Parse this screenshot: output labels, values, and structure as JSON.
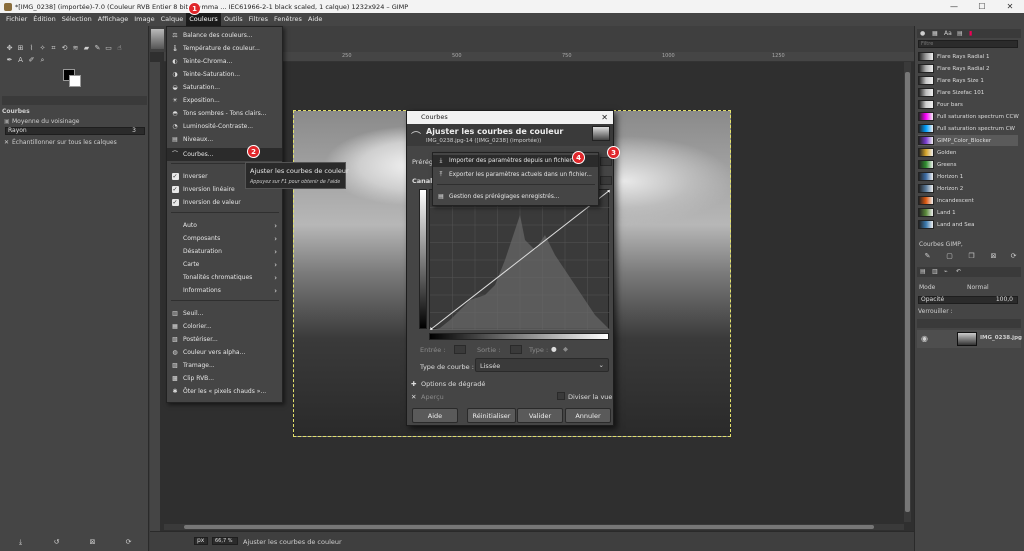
{
  "window": {
    "title": "*[IMG_0238] (importée)-7.0 (Couleur RVB Entier 8 bits gamma ... IEC61966-2-1 black scaled, 1 calque) 1232x924 – GIMP",
    "min": "—",
    "max": "☐",
    "close": "✕"
  },
  "menubar": [
    "Fichier",
    "Édition",
    "Sélection",
    "Affichage",
    "Image",
    "Calque",
    "Couleurs",
    "Outils",
    "Filtres",
    "Fenêtres",
    "Aide"
  ],
  "toolbox": {
    "panel_title": "Courbes",
    "average_label": "Moyenne du voisinage",
    "radius_label": "Rayon",
    "radius_value": "3",
    "sample_merged": "Échantillonner sur tous les calques"
  },
  "colors_menu": {
    "items": [
      {
        "label": "Balance des couleurs...",
        "icon": "⚖"
      },
      {
        "label": "Température de couleur...",
        "icon": "🌡"
      },
      {
        "label": "Teinte-Chroma...",
        "icon": "◐"
      },
      {
        "label": "Teinte-Saturation...",
        "icon": "◑"
      },
      {
        "label": "Saturation...",
        "icon": "◒"
      },
      {
        "label": "Exposition...",
        "icon": "☀"
      },
      {
        "label": "Tons sombres - Tons clairs...",
        "icon": "◓"
      },
      {
        "label": "Luminosité-Contraste...",
        "icon": "◔"
      },
      {
        "label": "Niveaux...",
        "icon": "▤"
      },
      {
        "label": "Courbes...",
        "icon": "⌒"
      },
      {
        "label": "Inverser",
        "icon": "✓"
      },
      {
        "label": "Inversion linéaire",
        "icon": "✓"
      },
      {
        "label": "Inversion de valeur",
        "icon": "✓"
      },
      {
        "label": "Auto"
      },
      {
        "label": "Composants"
      },
      {
        "label": "Désaturation"
      },
      {
        "label": "Carte"
      },
      {
        "label": "Tonalités chromatiques"
      },
      {
        "label": "Informations"
      },
      {
        "label": "Seuil...",
        "icon": "▥"
      },
      {
        "label": "Colorier...",
        "icon": "▦"
      },
      {
        "label": "Postériser...",
        "icon": "▧"
      },
      {
        "label": "Couleur vers alpha...",
        "icon": "◍"
      },
      {
        "label": "Tramage...",
        "icon": "▨"
      },
      {
        "label": "Clip RVB...",
        "icon": "▩"
      },
      {
        "label": "Ôter les « pixels chauds »...",
        "icon": "✱"
      }
    ]
  },
  "tooltip": {
    "title": "Ajuster les courbes de couleur",
    "help": "Appuyez sur F1 pour obtenir de l'aide"
  },
  "dialog": {
    "window_title": "Courbes",
    "heading": "Ajuster les courbes de couleur",
    "subheading": "IMG_0238.jpg-14 ([IMG_0238] (importée))",
    "presets_label": "Prérégl",
    "channel_label": "Canal",
    "entry_label": "Entrée :",
    "output_label": "Sortie :",
    "type_label": "Type :",
    "curve_type_label": "Type de courbe :",
    "curve_type_value": "Lissée",
    "gradient_options": "Options de dégradé",
    "preview": "Aperçu",
    "split_view": "Diviser la vue",
    "buttons": [
      "Aide",
      "Réinitialiser",
      "Valider",
      "Annuler"
    ],
    "presets_menu": [
      "Importer des paramètres depuis un fichier...",
      "Exporter les paramètres actuels dans un fichier...",
      "Gestion des préréglages enregistrés..."
    ]
  },
  "dock": {
    "filter_placeholder": "Filtre",
    "gradients": [
      {
        "name": "Flare Rays Radial 1",
        "color": "#9a9a9a"
      },
      {
        "name": "Flare Rays Radial 2",
        "color": "#b0b0b0"
      },
      {
        "name": "Flare Rays Size 1",
        "color": "#c8c8c8"
      },
      {
        "name": "Flare Sizefac 101",
        "color": "#bcbcbc"
      },
      {
        "name": "Four bars",
        "color": "#d0d0d0"
      },
      {
        "name": "Full saturation spectrum CCW",
        "color": "#ff00ff"
      },
      {
        "name": "Full saturation spectrum CW",
        "color": "#00a0ff"
      },
      {
        "name": "GIMP_Color_Blocker",
        "color": "#7a3bd0"
      },
      {
        "name": "Golden",
        "color": "#d8a62a"
      },
      {
        "name": "Greens",
        "color": "#2f8f2f"
      },
      {
        "name": "Horizon 1",
        "color": "#3d6ea8"
      },
      {
        "name": "Horizon 2",
        "color": "#5a7a9a"
      },
      {
        "name": "Incandescent",
        "color": "#e05a10"
      },
      {
        "name": "Land 1",
        "color": "#5a8a3a"
      },
      {
        "name": "Land and Sea",
        "color": "#3a7ab0"
      }
    ],
    "selected_gradient": "GIMP_Color_Blocker",
    "preset_label": "Courbes GIMP,",
    "mode_label": "Mode",
    "mode_value": "Normal",
    "opacity_label": "Opacité",
    "opacity_value": "100,0",
    "lock_label": "Verrouiller :",
    "layer_name": "IMG_0238.jpg"
  },
  "status": {
    "unit": "px",
    "zoom": "66,7 %",
    "message": "Ajuster les courbes de couleur"
  },
  "ruler_ticks": [
    "250",
    "500",
    "750",
    "1000",
    "1250"
  ],
  "badges": [
    "1",
    "2",
    "3",
    "4"
  ]
}
